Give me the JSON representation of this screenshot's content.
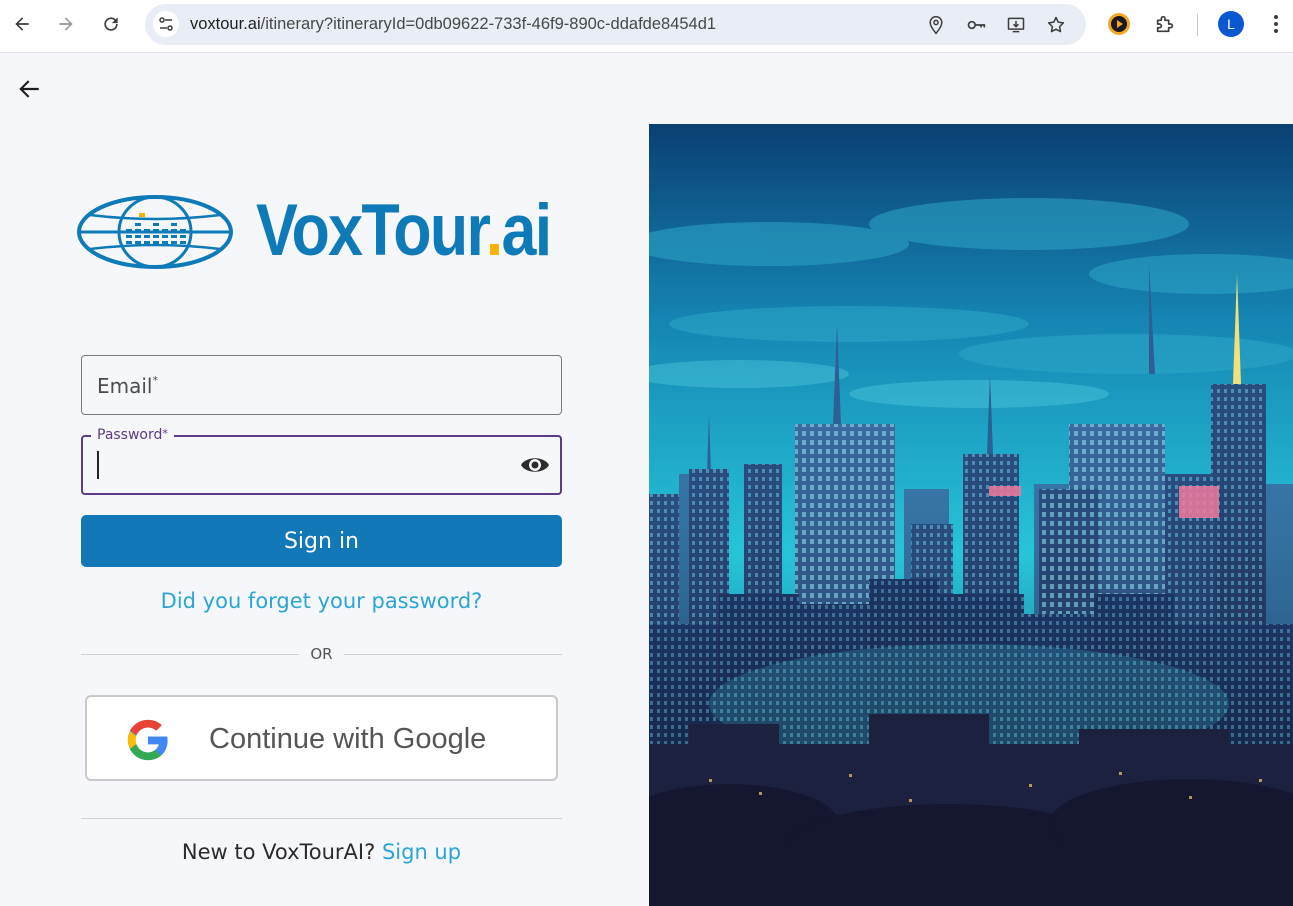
{
  "browser": {
    "url_host": "voxtour.ai",
    "url_path": "/itinerary?itineraryId=0db09622-733f-46f9-890c-ddafde8454d1",
    "profile_initial": "L"
  },
  "brand": {
    "name_main": "VoxTour",
    "name_dot": ".",
    "name_suffix": "ai"
  },
  "form": {
    "email_label": "Email",
    "password_label": "Password",
    "required_mark": "*",
    "signin_label": "Sign in",
    "forgot_label": "Did you forget your password?",
    "or_label": "OR",
    "google_label": "Continue with Google",
    "new_user_text": "New to VoxTourAI?",
    "signup_label": "Sign up"
  },
  "colors": {
    "brand_blue": "#0f7ab8",
    "accent_yellow": "#f4b400",
    "link_blue": "#2aa5d6",
    "focus_purple": "#5b3b86"
  }
}
